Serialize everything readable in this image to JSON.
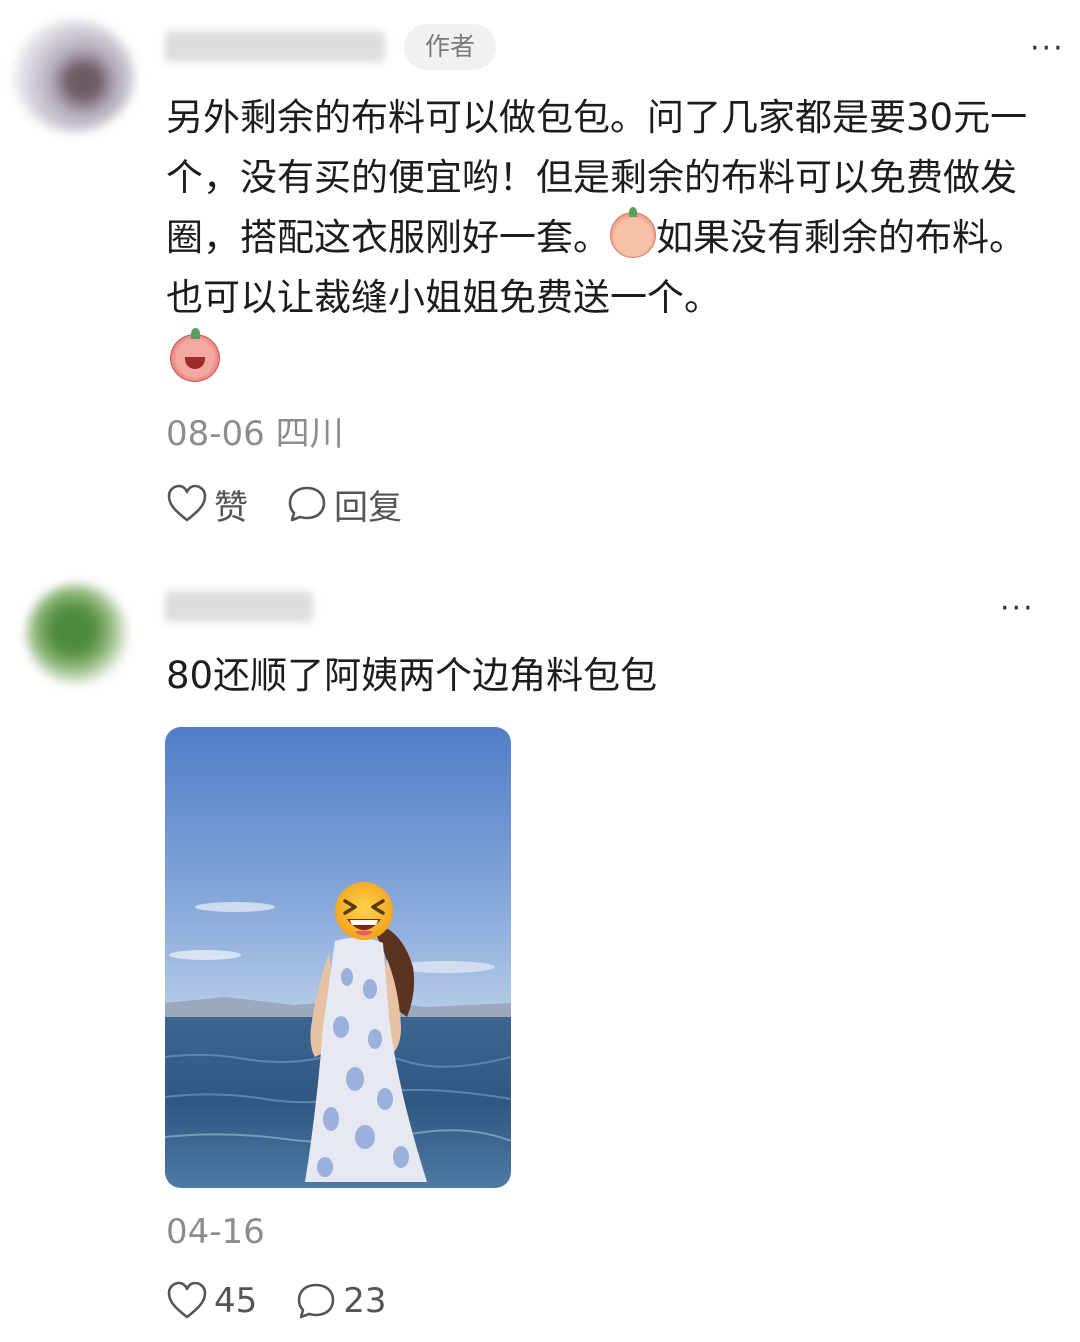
{
  "comments": [
    {
      "author_badge": "作者",
      "more_label": "···",
      "text_parts": [
        "另外剩余的布料可以做包包。问了几家都是要30元一个，没有买的便宜哟！但是剩余的布料可以免费做发圈，搭配这衣服刚好一套。",
        "如果没有剩余的布料。也可以让裁缝小姐姐免费送一个。"
      ],
      "emojis": [
        "shy-emoji",
        "laughing-emoji"
      ],
      "date": "08-06",
      "location": "四川",
      "like_label": "赞",
      "reply_label": "回复"
    },
    {
      "more_label": "···",
      "text": "80还顺了阿姨两个边角料包包",
      "image": "photo of a woman in a long white and blue patterned dress standing at the shore of a lake under a blue sky, face covered by a grinning emoji",
      "date": "04-16",
      "likes": "45",
      "replies": "23"
    }
  ],
  "colors": {
    "text": "#1d1d1d",
    "meta": "#8d8d8d",
    "badge_bg": "#f1f1f1",
    "badge_text": "#7a7a7a"
  }
}
